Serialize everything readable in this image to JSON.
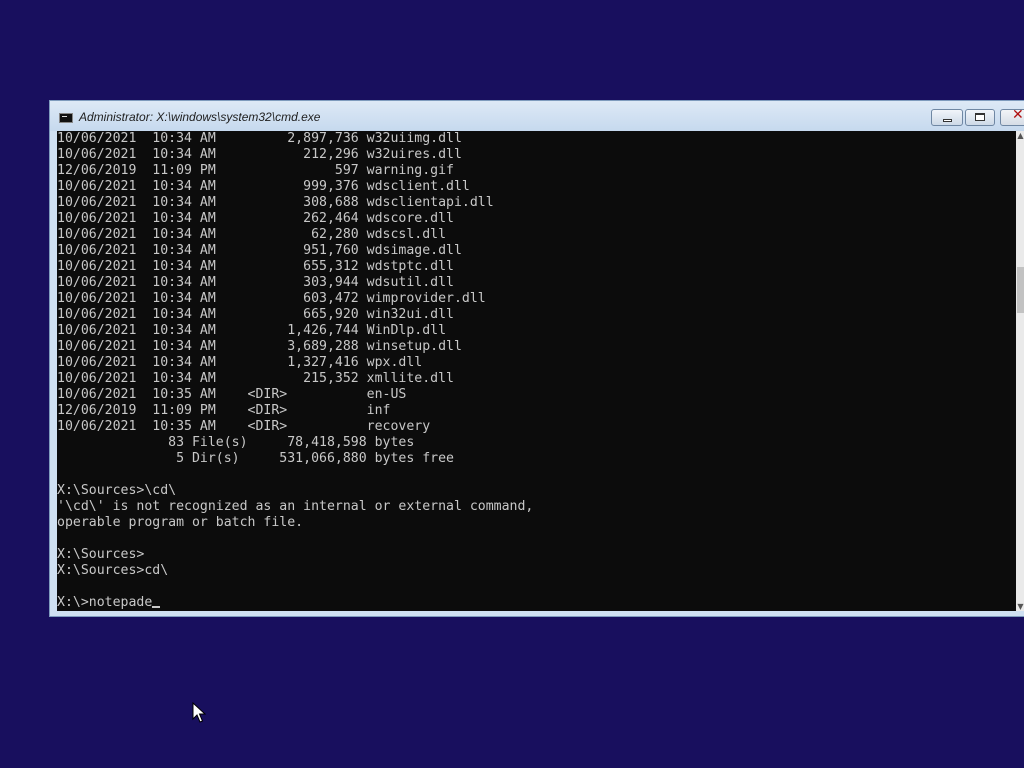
{
  "window": {
    "title": "Administrator: X:\\windows\\system32\\cmd.exe",
    "icon": "cmd-icon",
    "controls": {
      "minimize_icon": "minimize-icon",
      "maximize_icon": "maximize-icon",
      "close_icon": "close-icon",
      "close_glyph": "✕"
    }
  },
  "console": {
    "lines": [
      "10/06/2021  10:34 AM         2,897,736 w32uiimg.dll",
      "10/06/2021  10:34 AM           212,296 w32uires.dll",
      "12/06/2019  11:09 PM               597 warning.gif",
      "10/06/2021  10:34 AM           999,376 wdsclient.dll",
      "10/06/2021  10:34 AM           308,688 wdsclientapi.dll",
      "10/06/2021  10:34 AM           262,464 wdscore.dll",
      "10/06/2021  10:34 AM            62,280 wdscsl.dll",
      "10/06/2021  10:34 AM           951,760 wdsimage.dll",
      "10/06/2021  10:34 AM           655,312 wdstptc.dll",
      "10/06/2021  10:34 AM           303,944 wdsutil.dll",
      "10/06/2021  10:34 AM           603,472 wimprovider.dll",
      "10/06/2021  10:34 AM           665,920 win32ui.dll",
      "10/06/2021  10:34 AM         1,426,744 WinDlp.dll",
      "10/06/2021  10:34 AM         3,689,288 winsetup.dll",
      "10/06/2021  10:34 AM         1,327,416 wpx.dll",
      "10/06/2021  10:34 AM           215,352 xmllite.dll",
      "10/06/2021  10:35 AM    <DIR>          en-US",
      "12/06/2019  11:09 PM    <DIR>          inf",
      "10/06/2021  10:35 AM    <DIR>          recovery",
      "              83 File(s)     78,418,598 bytes",
      "               5 Dir(s)     531,066,880 bytes free",
      "",
      "X:\\Sources>\\cd\\",
      "'\\cd\\' is not recognized as an internal or external command,",
      "operable program or batch file.",
      "",
      "X:\\Sources>",
      "X:\\Sources>cd\\",
      ""
    ],
    "prompt": "X:\\>",
    "input": "notepade"
  },
  "scrollbar": {
    "up_arrow": "▲",
    "down_arrow": "▼"
  },
  "colors": {
    "desktop": "#180f5e",
    "console_bg": "#0c0c0c",
    "console_fg": "#c8c8c8"
  }
}
